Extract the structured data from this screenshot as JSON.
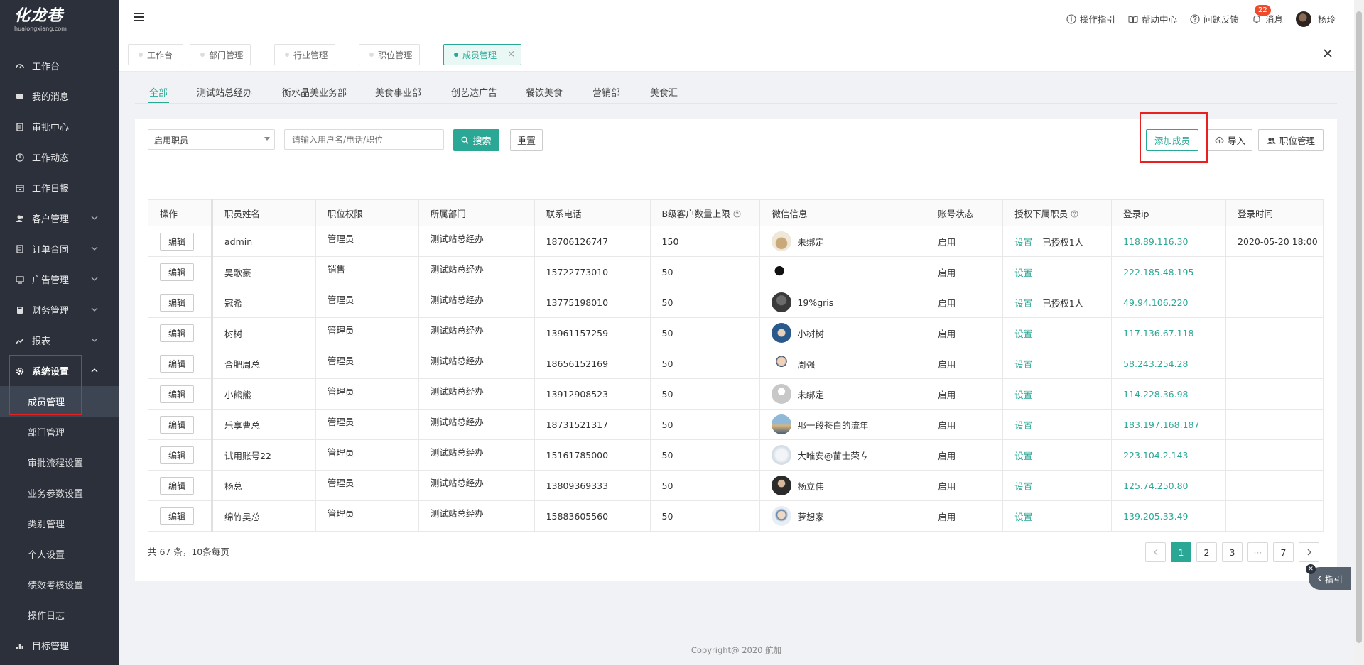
{
  "logo": {
    "brand": "化龙巷",
    "domain": "hualongxiang.com"
  },
  "sidebar": {
    "items": [
      {
        "label": "工作台",
        "icon": "dashboard-icon"
      },
      {
        "label": "我的消息",
        "icon": "message-icon"
      },
      {
        "label": "审批中心",
        "icon": "approval-icon"
      },
      {
        "label": "工作动态",
        "icon": "clock-icon"
      },
      {
        "label": "工作日报",
        "icon": "calendar-icon"
      },
      {
        "label": "客户管理",
        "icon": "customer-icon",
        "expandable": true
      },
      {
        "label": "订单合同",
        "icon": "contract-icon",
        "expandable": true
      },
      {
        "label": "广告管理",
        "icon": "monitor-icon",
        "expandable": true
      },
      {
        "label": "财务管理",
        "icon": "finance-icon",
        "expandable": true
      },
      {
        "label": "报表",
        "icon": "chart-icon",
        "expandable": true
      },
      {
        "label": "系统设置",
        "icon": "gear-icon",
        "expandable": true,
        "expanded": true
      },
      {
        "label": "目标管理",
        "icon": "target-icon"
      }
    ],
    "sub_items": [
      "成员管理",
      "部门管理",
      "审批流程设置",
      "业务参数设置",
      "类别管理",
      "个人设置",
      "绩效考核设置",
      "操作日志"
    ],
    "current_sub": "成员管理"
  },
  "topbar": {
    "guide": "操作指引",
    "help": "帮助中心",
    "feedback": "问题反馈",
    "messages": "消息",
    "message_count": "22",
    "user": "杨玲"
  },
  "page_tabs": [
    {
      "label": "工作台",
      "closable": false
    },
    {
      "label": "部门管理",
      "closable": true
    },
    {
      "label": "行业管理",
      "closable": true
    },
    {
      "label": "职位管理",
      "closable": true
    },
    {
      "label": "成员管理",
      "closable": true,
      "active": true
    }
  ],
  "dept_tabs": [
    "全部",
    "测试站总经办",
    "衡水晶美业务部",
    "美食事业部",
    "创艺达广告",
    "餐饮美食",
    "营销部",
    "美食汇"
  ],
  "filters": {
    "status_select": "启用职员",
    "search_placeholder": "请输入用户名/电话/职位",
    "search_label": "搜索",
    "reset_label": "重置"
  },
  "actions": {
    "add": "添加成员",
    "import": "导入",
    "positions": "职位管理"
  },
  "table": {
    "headers": [
      "操作",
      "职员姓名",
      "职位权限",
      "所属部门",
      "联系电话",
      "B级客户数量上限",
      "微信信息",
      "账号状态",
      "授权下属职员",
      "登录ip",
      "登录时间"
    ],
    "edit_label": "编辑",
    "set_label": "设置",
    "rows": [
      {
        "name": "admin",
        "role": "管理员",
        "dept": "测试站总经办",
        "phone": "18706126747",
        "limit": "150",
        "wechat": "未绑定",
        "status": "启用",
        "auth": "已授权1人",
        "ip": "118.89.116.30",
        "login": "2020-05-20 18:00"
      },
      {
        "name": "吴歌豪",
        "role": "销售",
        "dept": "测试站总经办",
        "phone": "15722773010",
        "limit": "50",
        "wechat": "",
        "status": "启用",
        "auth": "",
        "ip": "222.185.48.195",
        "login": ""
      },
      {
        "name": "冠希",
        "role": "管理员",
        "dept": "测试站总经办",
        "phone": "13775198010",
        "limit": "50",
        "wechat": "19%gris",
        "status": "启用",
        "auth": "已授权1人",
        "ip": "49.94.106.220",
        "login": ""
      },
      {
        "name": "树树",
        "role": "管理员",
        "dept": "测试站总经办",
        "phone": "13961157259",
        "limit": "50",
        "wechat": "小树树",
        "status": "启用",
        "auth": "",
        "ip": "117.136.67.118",
        "login": ""
      },
      {
        "name": "合肥周总",
        "role": "管理员",
        "dept": "测试站总经办",
        "phone": "18656152169",
        "limit": "50",
        "wechat": "周强",
        "status": "启用",
        "auth": "",
        "ip": "58.243.254.28",
        "login": ""
      },
      {
        "name": "小熊熊",
        "role": "管理员",
        "dept": "测试站总经办",
        "phone": "13912908523",
        "limit": "50",
        "wechat": "未绑定",
        "status": "启用",
        "auth": "",
        "ip": "114.228.36.98",
        "login": ""
      },
      {
        "name": "乐享曹总",
        "role": "管理员",
        "dept": "测试站总经办",
        "phone": "18731521317",
        "limit": "50",
        "wechat": "那一段苍白的流年",
        "status": "启用",
        "auth": "",
        "ip": "183.197.168.187",
        "login": ""
      },
      {
        "name": "试用账号22",
        "role": "管理员",
        "dept": "测试站总经办",
        "phone": "15161785000",
        "limit": "50",
        "wechat": "大唯安@苗士荣ㄘ",
        "status": "启用",
        "auth": "",
        "ip": "223.104.2.143",
        "login": ""
      },
      {
        "name": "杨总",
        "role": "管理员",
        "dept": "测试站总经办",
        "phone": "13809369333",
        "limit": "50",
        "wechat": "杨立伟",
        "status": "启用",
        "auth": "",
        "ip": "125.74.250.80",
        "login": ""
      },
      {
        "name": "绵竹吴总",
        "role": "管理员",
        "dept": "测试站总经办",
        "phone": "15883605560",
        "limit": "50",
        "wechat": "萝想家",
        "status": "启用",
        "auth": "",
        "ip": "139.205.33.49",
        "login": ""
      }
    ]
  },
  "pagination": {
    "summary": "共 67 条，10条每页",
    "pages": [
      "1",
      "2",
      "3",
      "···",
      "7"
    ],
    "current": "1"
  },
  "guide_label": "指引",
  "copyright": "Copyright@ 2020 航加",
  "colors": {
    "accent": "#2ba895",
    "sidebar": "#2b303b",
    "highlight": "#e8201f",
    "badge": "#f04a2c"
  }
}
